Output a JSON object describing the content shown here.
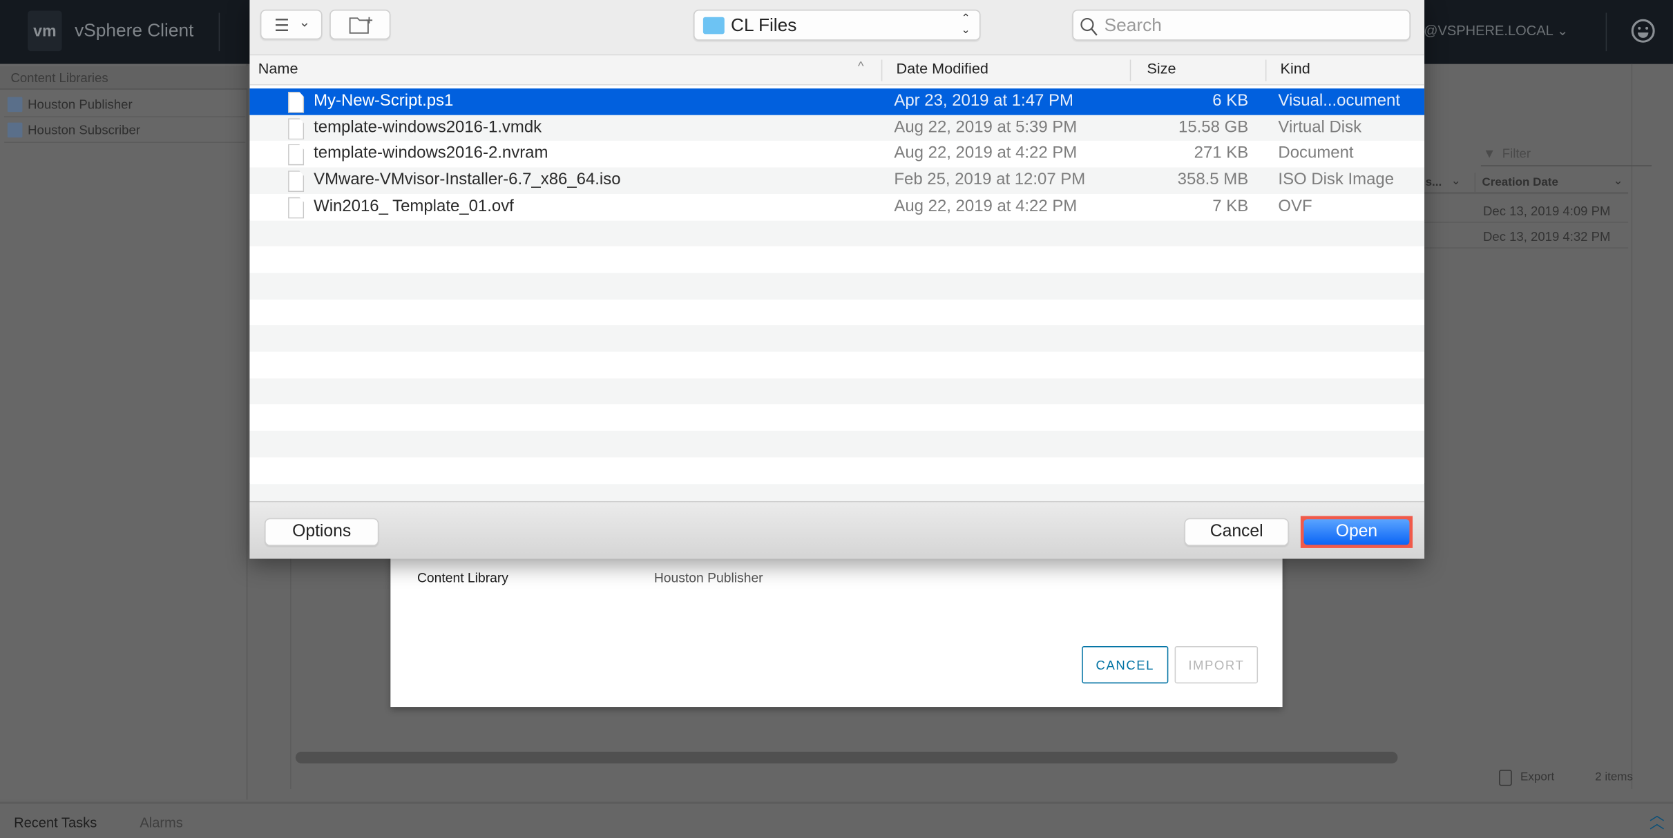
{
  "app": {
    "logo": "vm",
    "title": "vSphere Client",
    "user": "@VSPHERE.LOCAL",
    "user_icon": "smiley-icon"
  },
  "sidebar": {
    "header": "Content Libraries",
    "items": [
      {
        "label": "Houston Publisher",
        "icon": "publisher-library-icon"
      },
      {
        "label": "Houston Subscriber",
        "icon": "subscriber-library-icon"
      }
    ]
  },
  "main": {
    "filter_placeholder": "Filter",
    "columns": [
      "s...",
      "Creation Date"
    ],
    "rows": [
      "Dec 13, 2019 4:09 PM",
      "Dec 13, 2019 4:32 PM"
    ],
    "export_label": "Export",
    "item_count": "2 items"
  },
  "bottom": {
    "tabs": [
      "Recent Tasks",
      "Alarms"
    ]
  },
  "import_modal": {
    "label": "Content Library",
    "value": "Houston Publisher",
    "cancel": "CANCEL",
    "import": "IMPORT",
    "accent": "#0072a3"
  },
  "file_dialog": {
    "location": "CL Files",
    "search_placeholder": "Search",
    "columns": {
      "name": "Name",
      "date": "Date Modified",
      "size": "Size",
      "kind": "Kind"
    },
    "files": [
      {
        "name": "My-New-Script.ps1",
        "date": "Apr 23, 2019 at 1:47 PM",
        "size": "6 KB",
        "kind": "Visual...ocument",
        "icon": "powershell-file-icon",
        "selected": true
      },
      {
        "name": "template-windows2016-1.vmdk",
        "date": "Aug 22, 2019 at 5:39 PM",
        "size": "15.58 GB",
        "kind": "Virtual Disk",
        "icon": "vmdk-file-icon"
      },
      {
        "name": "template-windows2016-2.nvram",
        "date": "Aug 22, 2019 at 4:22 PM",
        "size": "271 KB",
        "kind": "Document",
        "icon": "document-file-icon"
      },
      {
        "name": "VMware-VMvisor-Installer-6.7_x86_64.iso",
        "date": "Feb 25, 2019 at 12:07 PM",
        "size": "358.5 MB",
        "kind": "ISO Disk Image",
        "icon": "disk-image-icon"
      },
      {
        "name": "Win2016_ Template_01.ovf",
        "date": "Aug 22, 2019 at 4:22 PM",
        "size": "7 KB",
        "kind": "OVF",
        "icon": "document-file-icon"
      }
    ],
    "options": "Options",
    "cancel": "Cancel",
    "open": "Open",
    "selection_color": "#0160de",
    "highlight_color": "#f05a4a"
  }
}
